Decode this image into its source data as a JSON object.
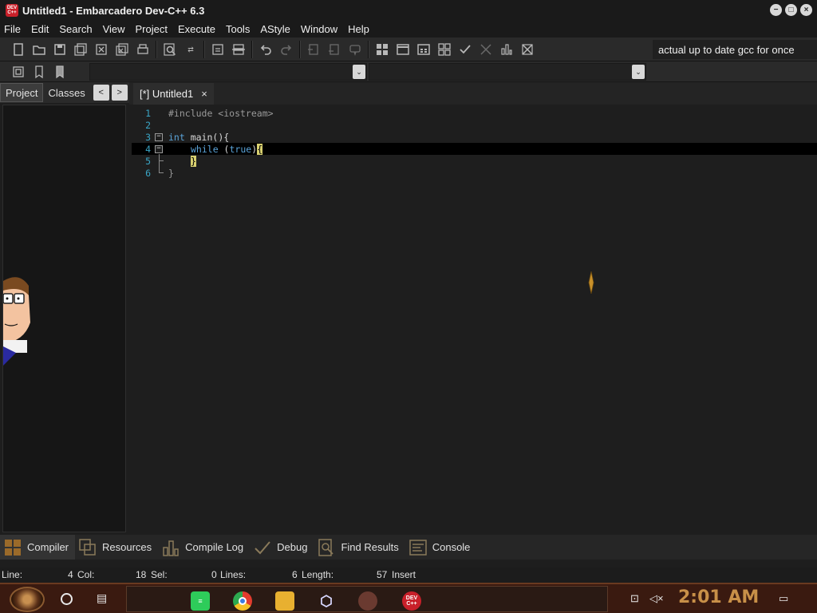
{
  "window": {
    "title": "Untitled1 - Embarcadero Dev-C++ 6.3",
    "app_icon_text": "DEV C++",
    "controls": [
      "−",
      "□",
      "×"
    ]
  },
  "menu": [
    "File",
    "Edit",
    "Search",
    "View",
    "Project",
    "Execute",
    "Tools",
    "AStyle",
    "Window",
    "Help"
  ],
  "toolbar": {
    "compiler_set": "actual up to date gcc for once",
    "combo_arrow": "⌄"
  },
  "left_panel": {
    "tabs": [
      "Project",
      "Classes"
    ],
    "nav_prev": "<",
    "nav_next": ">"
  },
  "editor": {
    "tab_label": "[*] Untitled1",
    "tab_close": "×",
    "lines": [
      {
        "num": "1",
        "text": "#include <iostream>"
      },
      {
        "num": "2",
        "text": ""
      },
      {
        "num": "3",
        "text": "int main(){"
      },
      {
        "num": "4",
        "text": "while (true){"
      },
      {
        "num": "5",
        "text": "}"
      },
      {
        "num": "6",
        "text": "}"
      }
    ],
    "tokens": {
      "int": "int",
      "main": " main(){",
      "while": "while",
      "cond_open": " (",
      "true": "true",
      "cond_close": ")",
      "open_brace": "{",
      "close_brace": "}"
    }
  },
  "bottom_tabs": [
    "Compiler",
    "Resources",
    "Compile Log",
    "Debug",
    "Find Results",
    "Console"
  ],
  "status": {
    "line_label": "Line:",
    "line_value": "4",
    "col_label": "Col:",
    "col_value": "18",
    "sel_label": "Sel:",
    "sel_value": "0",
    "lines_label": "Lines:",
    "lines_value": "6",
    "length_label": "Length:",
    "length_value": "57",
    "mode": "Insert"
  },
  "taskbar": {
    "time": "2:01 AM",
    "dev_icon_text": "DEV C++"
  },
  "colors": {
    "accent_taskbar": "#3a1a10",
    "clock": "#c89048",
    "line_numbers": "#3aa6c6",
    "keyword": "#5aa3d8"
  }
}
